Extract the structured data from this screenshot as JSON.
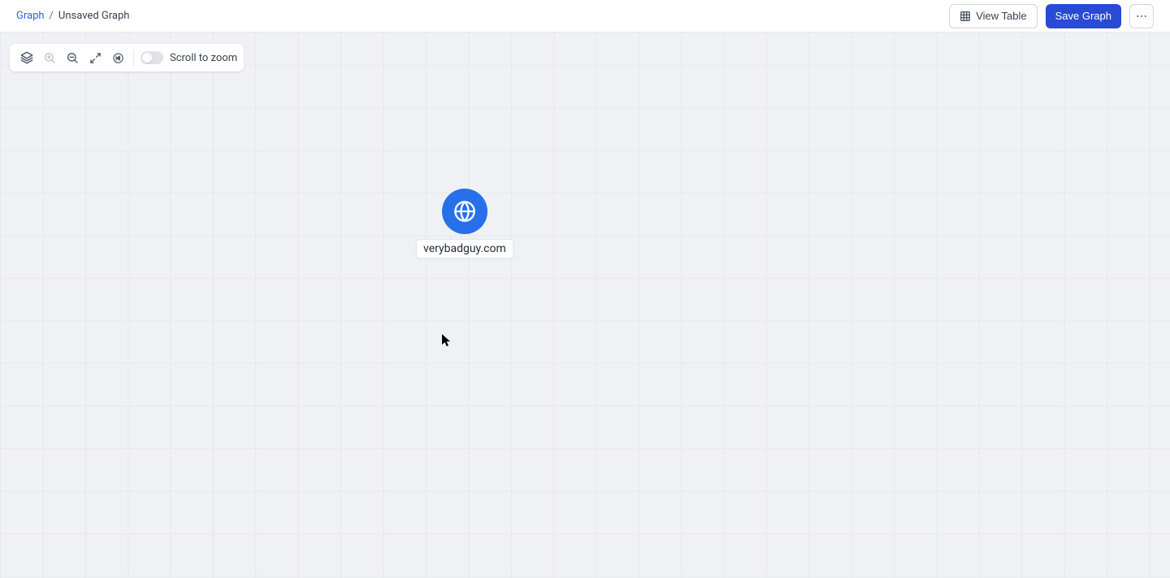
{
  "breadcrumb": {
    "root": "Graph",
    "separator": "/",
    "current": "Unsaved Graph"
  },
  "header": {
    "view_table_label": "View Table",
    "save_graph_label": "Save Graph"
  },
  "toolbar": {
    "scroll_to_zoom_label": "Scroll to zoom",
    "scroll_to_zoom_on": false
  },
  "node": {
    "label": "verybadguy.com",
    "icon": "globe-icon"
  }
}
